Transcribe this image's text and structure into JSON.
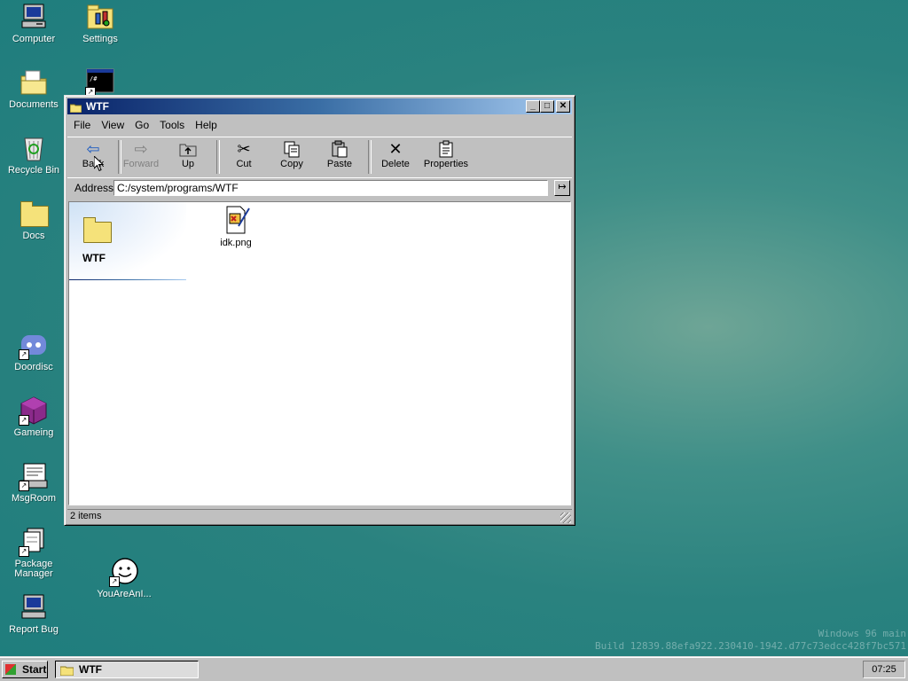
{
  "desktop": {
    "icons": [
      {
        "label": "Computer"
      },
      {
        "label": "Settings"
      },
      {
        "label": "Documents"
      },
      {
        "label": "Recycle Bin"
      },
      {
        "label": "Docs"
      },
      {
        "label": "Doordisc"
      },
      {
        "label": "Gameing"
      },
      {
        "label": "MsgRoom"
      },
      {
        "label": "Package Manager"
      },
      {
        "label": "YouAreAnI..."
      },
      {
        "label": "Report Bug"
      }
    ]
  },
  "window": {
    "title": "WTF",
    "menu": [
      "File",
      "View",
      "Go",
      "Tools",
      "Help"
    ],
    "toolbar": {
      "back": "Back",
      "forward": "Forward",
      "up": "Up",
      "cut": "Cut",
      "copy": "Copy",
      "paste": "Paste",
      "delete": "Delete",
      "properties": "Properties"
    },
    "address": {
      "label": "Address",
      "value": "C:/system/programs/WTF"
    },
    "side_panel_title": "WTF",
    "files": [
      {
        "name": "idk.png",
        "icon": "image-file-icon"
      }
    ],
    "status": "2 items"
  },
  "watermark": {
    "line1": "Windows 96 main",
    "line2": "Build 12839.88efa922.230410-1942.d77c73edcc428f7bc571"
  },
  "taskbar": {
    "start_label": "Start",
    "task_label": "WTF",
    "clock": "07:25"
  },
  "colors": {
    "desktop": "#2a827f",
    "title_active": "#0a246a",
    "face": "#c0c0c0"
  }
}
